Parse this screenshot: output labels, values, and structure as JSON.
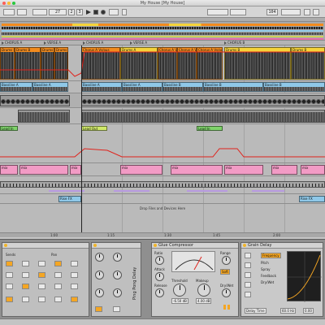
{
  "window": {
    "title": "My House  [My House]"
  },
  "control": {
    "bar": "27",
    "beat": "2",
    "sixteenth": "3",
    "zoom": "104"
  },
  "scene": {
    "locators": [
      {
        "name": "CHORUS A"
      },
      {
        "name": "VERSE A"
      },
      {
        "name": "CHORUS A"
      },
      {
        "name": "VERSE A"
      },
      {
        "name": "CHORUS B"
      }
    ]
  },
  "clips": {
    "chorus_a_vs": "Chorus A Vs/ous",
    "drums_b": "Drums B",
    "drums_a": "Drums A",
    "bassline_a": "Bassline A",
    "bassline_b": "Bassline B",
    "lead_in": "Lead In",
    "lead_out": "Lead Out",
    "mix": "mix",
    "rise_fx": "Rise FX",
    "drop_zone": "Drop Files and Devices Here"
  },
  "ruler": [
    "1:00",
    "1:15",
    "1:30",
    "1:45",
    "2:00"
  ],
  "devices": {
    "glue": {
      "title": "Glue Compressor",
      "ratio": "Ratio",
      "attack": "Attack",
      "release": "Release",
      "threshold": "Threshold",
      "makeup": "Makeup",
      "range": "Range",
      "drywet": "Dry/Wet",
      "val_threshold": "-6.50 dB",
      "val_makeup": "4.00 dB",
      "soft": "Soft"
    },
    "grain": {
      "title": "Grain Delay",
      "frequency": "Frequency",
      "pitch": "Pitch",
      "spray": "Spray",
      "feedback": "Feedback",
      "drywet": "Dry/Wet",
      "delay_time": "Delay Time",
      "val_freq": "60.0 Hz",
      "val_pitch": "0.00"
    },
    "left": {
      "title": "Ping Pong Delay",
      "vol": "Volume",
      "pan": "Pan",
      "sends": "Sends"
    }
  }
}
